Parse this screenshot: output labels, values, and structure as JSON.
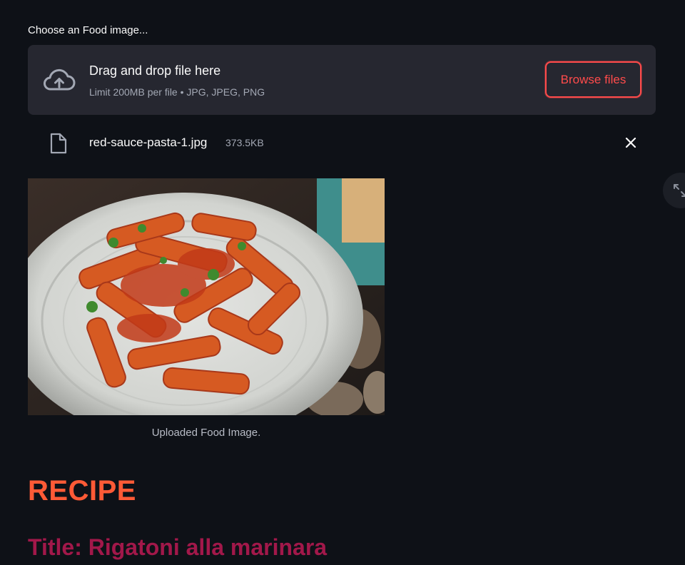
{
  "uploader": {
    "label": "Choose an Food image...",
    "drop_title": "Drag and drop file here",
    "drop_subtitle": "Limit 200MB per file • JPG, JPEG, PNG",
    "browse_label": "Browse files",
    "icon": "cloud-upload-icon"
  },
  "file": {
    "name": "red-sauce-pasta-1.jpg",
    "size": "373.5KB",
    "icon": "file-icon",
    "remove_icon": "close-icon"
  },
  "image": {
    "caption": "Uploaded Food Image."
  },
  "fullscreen": {
    "icon": "expand-icon"
  },
  "recipe": {
    "heading": "RECIPE",
    "title": "Title: Rigatoni alla marinara"
  },
  "colors": {
    "background": "#0e1117",
    "dropzone": "#262730",
    "accent": "#ff4b4b",
    "heading": "#ff5a36",
    "title": "#a2184a"
  }
}
